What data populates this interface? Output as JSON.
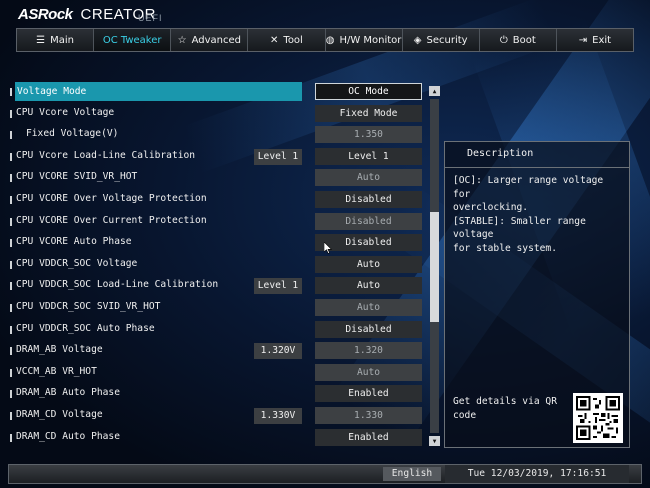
{
  "header": {
    "brand": "ASRock",
    "product": "CREATOR",
    "firmware": "UEFI"
  },
  "tabs": [
    {
      "label": "Main",
      "icon": "list-icon",
      "active": false
    },
    {
      "label": "OC Tweaker",
      "icon": "",
      "active": true
    },
    {
      "label": "Advanced",
      "icon": "star-icon",
      "active": false
    },
    {
      "label": "Tool",
      "icon": "tools-icon",
      "active": false
    },
    {
      "label": "H/W Monitor",
      "icon": "monitor-icon",
      "active": false
    },
    {
      "label": "Security",
      "icon": "shield-icon",
      "active": false
    },
    {
      "label": "Boot",
      "icon": "power-icon",
      "active": false
    },
    {
      "label": "Exit",
      "icon": "exit-icon",
      "active": false
    }
  ],
  "settings": [
    {
      "label": "Voltage Mode",
      "value": "OC Mode",
      "badge": "",
      "selected": true,
      "sub": false,
      "dim": false
    },
    {
      "label": "CPU Vcore Voltage",
      "value": "Fixed Mode",
      "badge": "",
      "selected": false,
      "sub": false,
      "dim": false
    },
    {
      "label": "Fixed Voltage(V)",
      "value": "1.350",
      "badge": "",
      "selected": false,
      "sub": true,
      "dim": true
    },
    {
      "label": "CPU Vcore Load-Line Calibration",
      "value": "Level 1",
      "badge": "Level 1",
      "selected": false,
      "sub": false,
      "dim": false
    },
    {
      "label": "CPU VCORE SVID_VR_HOT",
      "value": "Auto",
      "badge": "",
      "selected": false,
      "sub": false,
      "dim": true
    },
    {
      "label": "CPU VCORE Over Voltage Protection",
      "value": "Disabled",
      "badge": "",
      "selected": false,
      "sub": false,
      "dim": false
    },
    {
      "label": "CPU VCORE Over Current Protection",
      "value": "Disabled",
      "badge": "",
      "selected": false,
      "sub": false,
      "dim": true
    },
    {
      "label": "CPU VCORE Auto Phase",
      "value": "Disabled",
      "badge": "",
      "selected": false,
      "sub": false,
      "dim": false
    },
    {
      "label": "CPU VDDCR_SOC Voltage",
      "value": "Auto",
      "badge": "",
      "selected": false,
      "sub": false,
      "dim": false
    },
    {
      "label": "CPU VDDCR_SOC Load-Line Calibration",
      "value": "Auto",
      "badge": "Level 1",
      "selected": false,
      "sub": false,
      "dim": false
    },
    {
      "label": "CPU VDDCR_SOC SVID_VR_HOT",
      "value": "Auto",
      "badge": "",
      "selected": false,
      "sub": false,
      "dim": true
    },
    {
      "label": "CPU VDDCR_SOC Auto Phase",
      "value": "Disabled",
      "badge": "",
      "selected": false,
      "sub": false,
      "dim": false
    },
    {
      "label": "DRAM_AB Voltage",
      "value": "1.320",
      "badge": "1.320V",
      "selected": false,
      "sub": false,
      "dim": true
    },
    {
      "label": "VCCM_AB VR_HOT",
      "value": "Auto",
      "badge": "",
      "selected": false,
      "sub": false,
      "dim": true
    },
    {
      "label": "DRAM_AB Auto Phase",
      "value": "Enabled",
      "badge": "",
      "selected": false,
      "sub": false,
      "dim": false
    },
    {
      "label": "DRAM_CD Voltage",
      "value": "1.330",
      "badge": "1.330V",
      "selected": false,
      "sub": false,
      "dim": true
    },
    {
      "label": "DRAM_CD Auto Phase",
      "value": "Enabled",
      "badge": "",
      "selected": false,
      "sub": false,
      "dim": false
    }
  ],
  "description": {
    "title": "Description",
    "lines": [
      "[OC]: Larger range voltage for",
      "overclocking.",
      "[STABLE]: Smaller range voltage",
      "for stable system."
    ],
    "qr_text_lines": [
      "Get details via QR",
      "code"
    ]
  },
  "footer": {
    "language": "English",
    "datetime": "Tue 12/03/2019, 17:16:51"
  },
  "colors": {
    "accent": "#1a97ad",
    "active_tab_text": "#3ad0e6"
  }
}
